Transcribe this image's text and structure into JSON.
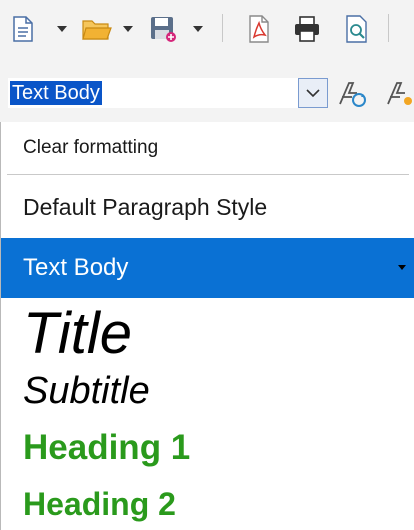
{
  "toolbar": {
    "icons": [
      "new-document-icon",
      "open-folder-icon",
      "save-icon",
      "export-pdf-icon",
      "print-icon",
      "print-preview-icon"
    ],
    "colors": {
      "folder": "#f2b233",
      "save": "#d5267b",
      "pdf": "#d9382f"
    }
  },
  "style_combo": {
    "value": "Text Body"
  },
  "style_list": {
    "clear_formatting": "Clear formatting",
    "items": [
      {
        "label": "Default Paragraph Style"
      },
      {
        "label": "Text Body",
        "selected": true
      },
      {
        "label": "Title"
      },
      {
        "label": "Subtitle"
      },
      {
        "label": "Heading 1",
        "color": "#2a9a1c"
      },
      {
        "label": "Heading 2",
        "color": "#2a9a1c"
      }
    ],
    "colors": {
      "selection": "#0a71d4",
      "heading": "#2a9a1c"
    }
  }
}
